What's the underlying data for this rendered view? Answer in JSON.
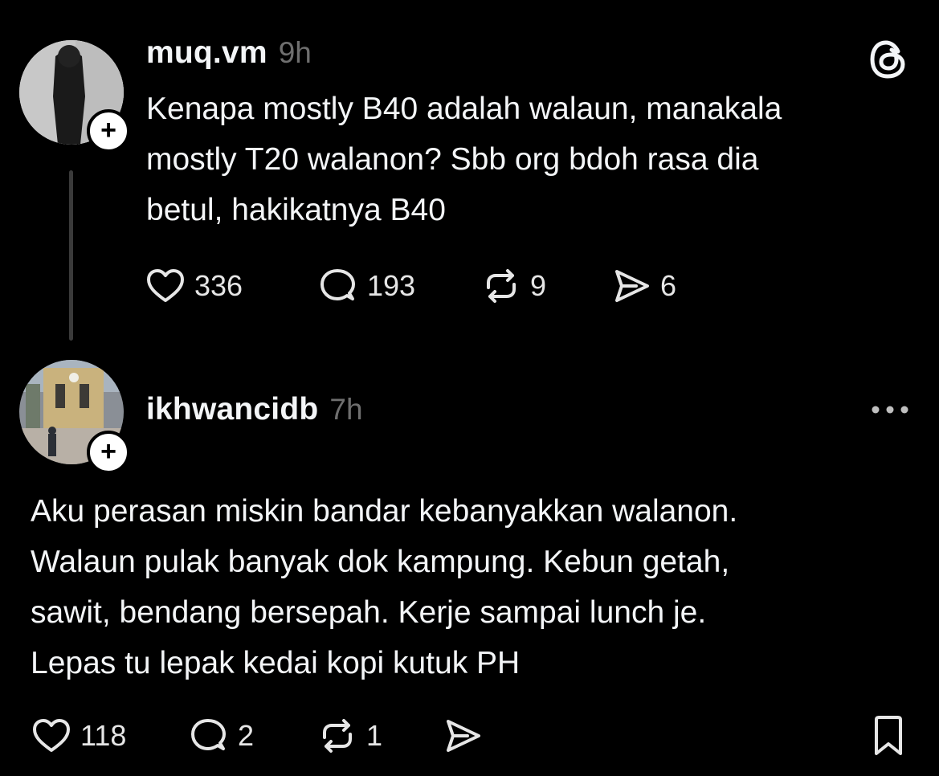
{
  "post": {
    "username": "muq.vm",
    "time": "9h",
    "text": "Kenapa mostly B40 adalah walaun, manakala\nmostly T20 walanon? Sbb org bdoh rasa dia\nbetul, hakikatnya B40",
    "likes": "336",
    "replies": "193",
    "reposts": "9",
    "shares": "6"
  },
  "reply": {
    "username": "ikhwancidb",
    "time": "7h",
    "text": "Aku perasan miskin bandar kebanyakkan walanon.\nWalaun pulak banyak dok kampung. Kebun getah,\nsawit, bendang bersepah. Kerje sampai lunch je.\nLepas tu lepak kedai kopi kutuk PH",
    "likes": "118",
    "replies": "2",
    "reposts": "1"
  },
  "icons": {
    "brand": "threads-logo-icon",
    "follow": "plus-icon",
    "like": "heart-icon",
    "reply": "comment-icon",
    "repost": "repost-icon",
    "share": "send-icon",
    "more": "more-horizontal-icon",
    "save": "bookmark-icon"
  },
  "colors": {
    "background": "#000000",
    "text": "#f3f5f7",
    "muted": "#6f6f6f",
    "thread_line": "#3a3a3a"
  }
}
